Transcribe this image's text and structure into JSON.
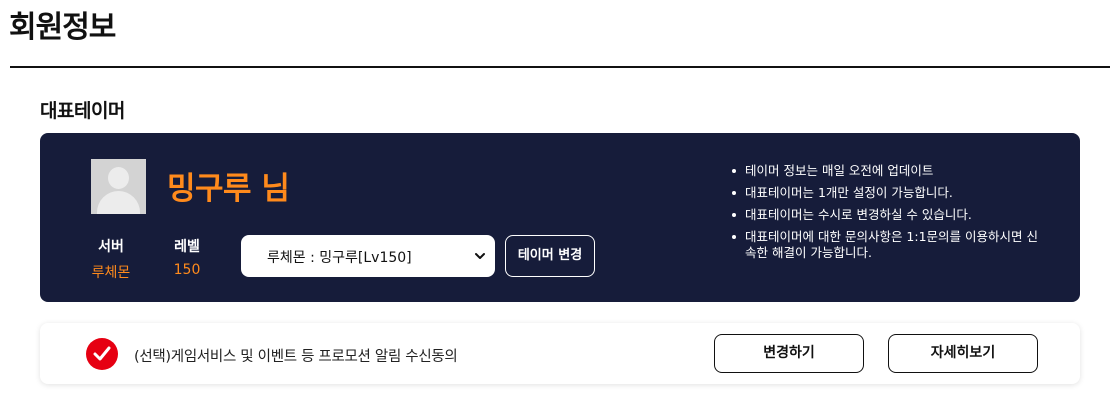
{
  "page": {
    "title": "회원정보"
  },
  "representative": {
    "section_title": "대표테이머",
    "nickname": "밍구루 님",
    "server": {
      "label": "서버",
      "value": "루체몬"
    },
    "level": {
      "label": "레벨",
      "value": "150"
    },
    "tamer_select": {
      "selected": "루체몬 : 밍구루[Lv150]"
    },
    "change_button": "테이머 변경",
    "notices": [
      "테이머 정보는 매일 오전에 업데이트",
      "대표테이머는 1개만 설정이 가능합니다.",
      "대표테이머는 수시로 변경하실 수 있습니다.",
      "대표테이머에 대한 문의사항은 1:1문의를 이용하시면 신속한 해결이 가능합니다."
    ],
    "colors": {
      "card_bg": "#161c3a",
      "accent": "#ff8a1c"
    }
  },
  "consent": {
    "text": "(선택)게임서비스 및 이벤트 등 프로모션 알림 수신동의",
    "checked": true,
    "check_color": "#e60012",
    "change_button": "변경하기",
    "detail_button": "자세히보기"
  }
}
